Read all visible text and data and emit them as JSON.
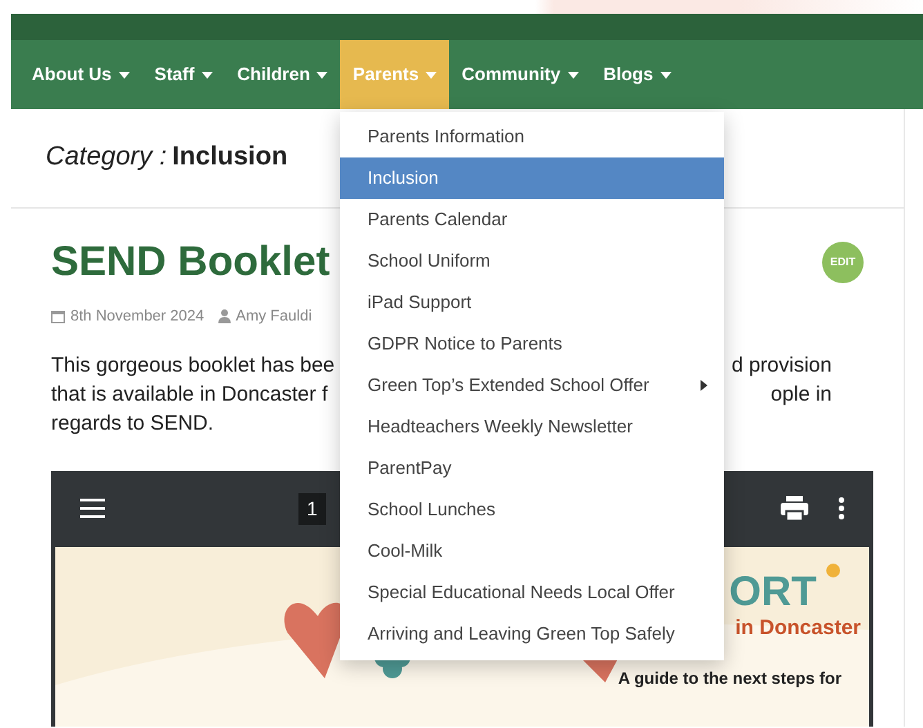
{
  "nav": [
    {
      "label": "About Us",
      "selected": false
    },
    {
      "label": "Staff",
      "selected": false
    },
    {
      "label": "Children",
      "selected": false
    },
    {
      "label": "Parents",
      "selected": true
    },
    {
      "label": "Community",
      "selected": false
    },
    {
      "label": "Blogs",
      "selected": false
    }
  ],
  "dropdown": [
    {
      "label": "Parents Information",
      "selected": false,
      "has_submenu": false
    },
    {
      "label": "Inclusion",
      "selected": true,
      "has_submenu": false
    },
    {
      "label": "Parents Calendar",
      "selected": false,
      "has_submenu": false
    },
    {
      "label": "School Uniform",
      "selected": false,
      "has_submenu": false
    },
    {
      "label": "iPad Support",
      "selected": false,
      "has_submenu": false
    },
    {
      "label": "GDPR Notice to Parents",
      "selected": false,
      "has_submenu": false
    },
    {
      "label": "Green Top’s Extended School Offer",
      "selected": false,
      "has_submenu": true
    },
    {
      "label": "Headteachers Weekly Newsletter",
      "selected": false,
      "has_submenu": false
    },
    {
      "label": "ParentPay",
      "selected": false,
      "has_submenu": false
    },
    {
      "label": "School Lunches",
      "selected": false,
      "has_submenu": false
    },
    {
      "label": "Cool-Milk",
      "selected": false,
      "has_submenu": false
    },
    {
      "label": "Special Educational Needs Local Offer",
      "selected": false,
      "has_submenu": false
    },
    {
      "label": "Arriving and Leaving Green Top Safely",
      "selected": false,
      "has_submenu": false
    }
  ],
  "category": {
    "prefix": "Category :",
    "name": "Inclusion"
  },
  "post": {
    "title": "SEND Booklet",
    "edit_badge": "EDIT",
    "date": "8th November 2024",
    "author": "Amy Fauldi",
    "paragraph_lines": [
      {
        "left": "This gorgeous booklet has bee",
        "right": "d provision"
      },
      {
        "left": "that is available in Doncaster f",
        "right": "ople in"
      },
      {
        "left": "regards to SEND."
      }
    ]
  },
  "pdf_viewer": {
    "page_number": "1",
    "document_texts": [
      "ORT",
      "in Doncaster",
      "A guide to the next steps for"
    ]
  }
}
